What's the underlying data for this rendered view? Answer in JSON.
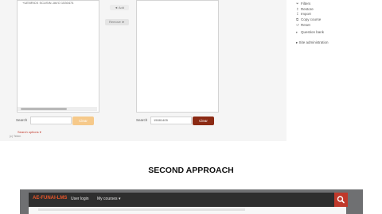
{
  "left_box": {
    "text": "+UENRICK SCUSIN JAVO 1530474"
  },
  "buttons": {
    "add": "◄ Add",
    "remove": "Remove ►"
  },
  "search": {
    "left_label": "Search",
    "left_value": "",
    "left_clear": "Clear",
    "right_label": "Search",
    "right_value": "15081405",
    "right_clear": "Clear",
    "options": "Search options ▾",
    "note": "(c) Telem"
  },
  "admin_menu": {
    "items": [
      {
        "icon": "filter-icon",
        "glyph": "⏷",
        "label": "Filters"
      },
      {
        "icon": "restore-icon",
        "glyph": "↥",
        "label": "Restore"
      },
      {
        "icon": "import-icon",
        "glyph": "↧",
        "label": "Import"
      },
      {
        "icon": "copy-icon",
        "glyph": "⧉",
        "label": "Copy course"
      },
      {
        "icon": "reset-icon",
        "glyph": "↺",
        "label": "Reset"
      },
      {
        "icon": "chevron-right-icon",
        "glyph": "▸",
        "label": "Question bank"
      }
    ],
    "site_admin": "▸ Site administration"
  },
  "heading": "SECOND APPROACH",
  "navbar": {
    "brand": "AE-FUNAI-LMS",
    "links": [
      "User login",
      "My courses ▾"
    ]
  },
  "colors": {
    "accent_red": "#c0392b",
    "clear_disabled": "#f6c98a",
    "clear_active": "#8b2a14",
    "navbar": "#2e2e2e"
  }
}
